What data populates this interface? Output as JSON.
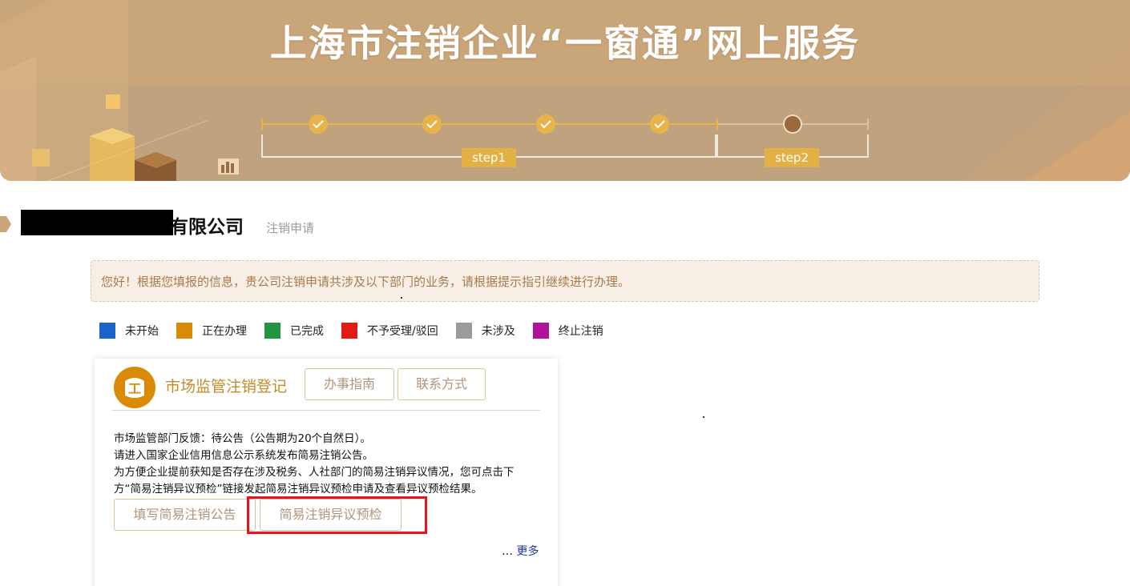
{
  "banner": {
    "title": "上海市注销企业“一窗通”网上服务",
    "steps": [
      {
        "label": "step1",
        "checkpoints_done": 4
      },
      {
        "label": "step2",
        "checkpoints_done": 0
      }
    ]
  },
  "heading": {
    "company_name": "有限公司",
    "subtitle": "注销申请"
  },
  "notice": {
    "text": "您好！根据您填报的信息，贵公司注销申请共涉及以下部门的业务，请根据提示指引继续进行办理。"
  },
  "legend": [
    {
      "label": "未开始",
      "color": "#1c63c9"
    },
    {
      "label": "正在办理",
      "color": "#d98b08"
    },
    {
      "label": "已完成",
      "color": "#239541"
    },
    {
      "label": "不予受理/驳回",
      "color": "#e21a12"
    },
    {
      "label": "未涉及",
      "color": "#9b9b9b"
    },
    {
      "label": "终止注销",
      "color": "#b0129c"
    }
  ],
  "card": {
    "icon": "gongshang-badge-icon",
    "icon_char": "工",
    "title": "市场监管注销登记",
    "guide_button": "办事指南",
    "contact_button": "联系方式",
    "lines": [
      "市场监管部门反馈：待公告（公告期为20个自然日）。",
      "请进入国家企业信用信息公示系统发布简易注销公告。",
      "为方便企业提前获知是否存在涉及税务、人社部门的简易注销异议情况，您可点击下",
      "方“简易注销异议预检”链接发起简易注销异议预检申请及查看异议预检结果。"
    ],
    "fill_button": "填写简易注销公告",
    "precheck_button": "简易注销异议预检",
    "more_prefix": "…",
    "more_link": "更多"
  },
  "colors": {
    "accent": "#c78a2a",
    "banner": "#c6a680",
    "step_label": "#e3b043",
    "highlight": "#e8141b"
  }
}
